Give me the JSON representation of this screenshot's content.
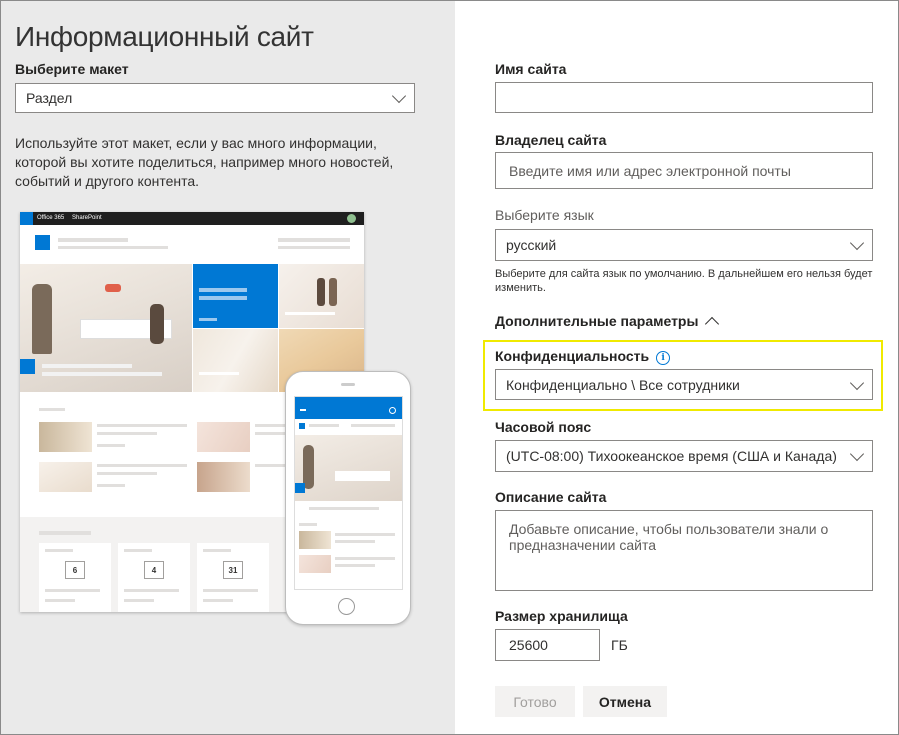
{
  "left": {
    "title": "Информационный сайт",
    "layout_label": "Выберите макет",
    "layout_value": "Раздел",
    "description": "Используйте этот макет, если у вас много информации, которой вы хотите поделиться, например много новостей, событий и другого контента.",
    "preview": {
      "brand": "Office 365",
      "app": "SharePoint",
      "calendar_days": [
        "6",
        "4",
        "31"
      ]
    }
  },
  "form": {
    "site_name_label": "Имя сайта",
    "site_name_value": "",
    "owner_label": "Владелец сайта",
    "owner_placeholder": "Введите имя или адрес электронной почты",
    "language_label": "Выберите язык",
    "language_value": "русский",
    "language_hint": "Выберите для сайта язык по умолчанию. В дальнейшем его нельзя будет изменить.",
    "advanced_label": "Дополнительные параметры",
    "privacy_label": "Конфиденциальность",
    "privacy_value": "Конфиденциально \\ Все сотрудники",
    "timezone_label": "Часовой пояс",
    "timezone_value": "(UTC-08:00) Тихоокеанское время (США и Канада)",
    "description_label": "Описание сайта",
    "description_placeholder": "Добавьте описание, чтобы пользователи знали о предназначении сайта",
    "storage_label": "Размер хранилища",
    "storage_value": "25600",
    "storage_unit": "ГБ",
    "done_label": "Готово",
    "cancel_label": "Отмена"
  },
  "colors": {
    "accent": "#0078d4",
    "highlight": "#f0ea00",
    "left_bg": "#eaeaea"
  }
}
